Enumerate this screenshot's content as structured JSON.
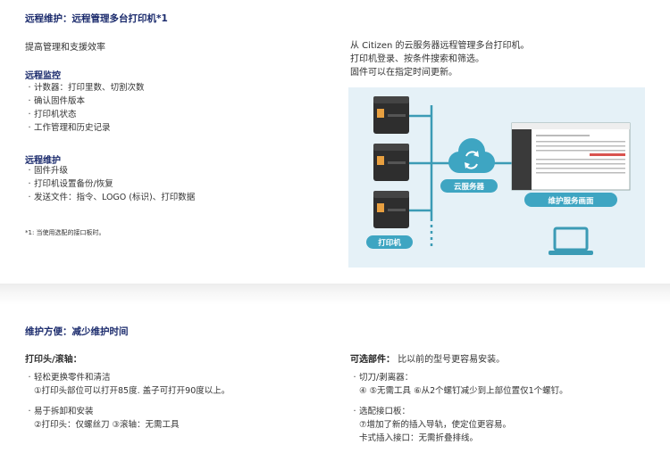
{
  "section1": {
    "title": "远程维护：远程管理多台打印机*1",
    "intro": "提高管理和支援效率",
    "monitoring": {
      "heading": "远程监控",
      "items": [
        "计数器：打印里数、切割次数",
        "确认固件版本",
        "打印机状态",
        "工作管理和历史记录"
      ]
    },
    "maintenance": {
      "heading": "远程维护",
      "items": [
        "固件升级",
        "打印机设置备份/恢复",
        "发送文件：指令、LOGO (标识)、打印数据"
      ]
    },
    "footnote": "*1: 当使用选配的接口板时。",
    "description": [
      "从 Citizen 的云服务器远程管理多台打印机。",
      "打印机登录、按条件搜索和筛选。",
      "固件可以在指定时间更新。"
    ],
    "diagram": {
      "printer_label": "打印机",
      "cloud_label": "云服务器",
      "screen_label": "维护服务画面",
      "accent_color": "#3ea5c2",
      "line_color": "#3b9bb5"
    }
  },
  "section2": {
    "title": "维护方便：减少维护时间",
    "left": {
      "heading": "打印头/滚轴：",
      "items": [
        {
          "label": "轻松更换零件和清洁",
          "detail": "①打印头部位可以打开85度. 盖子可打开90度以上。"
        },
        {
          "label": "易于拆卸和安装",
          "detail": "②打印头：仅螺丝刀 ③滚轴：无需工具"
        }
      ]
    },
    "right": {
      "heading": "可选部件：",
      "heading_note": "比以前的型号更容易安装。",
      "items": [
        {
          "label": "切刀/剥离器：",
          "detail": "④ ⑤无需工具 ⑥从2个螺钉减少到上部位置仅1个螺钉。"
        },
        {
          "label": "选配接口板：",
          "detail": "⑦增加了新的插入导轨，使定位更容易。",
          "detail2": "卡式插入接口：无需折叠排线。"
        }
      ]
    }
  }
}
